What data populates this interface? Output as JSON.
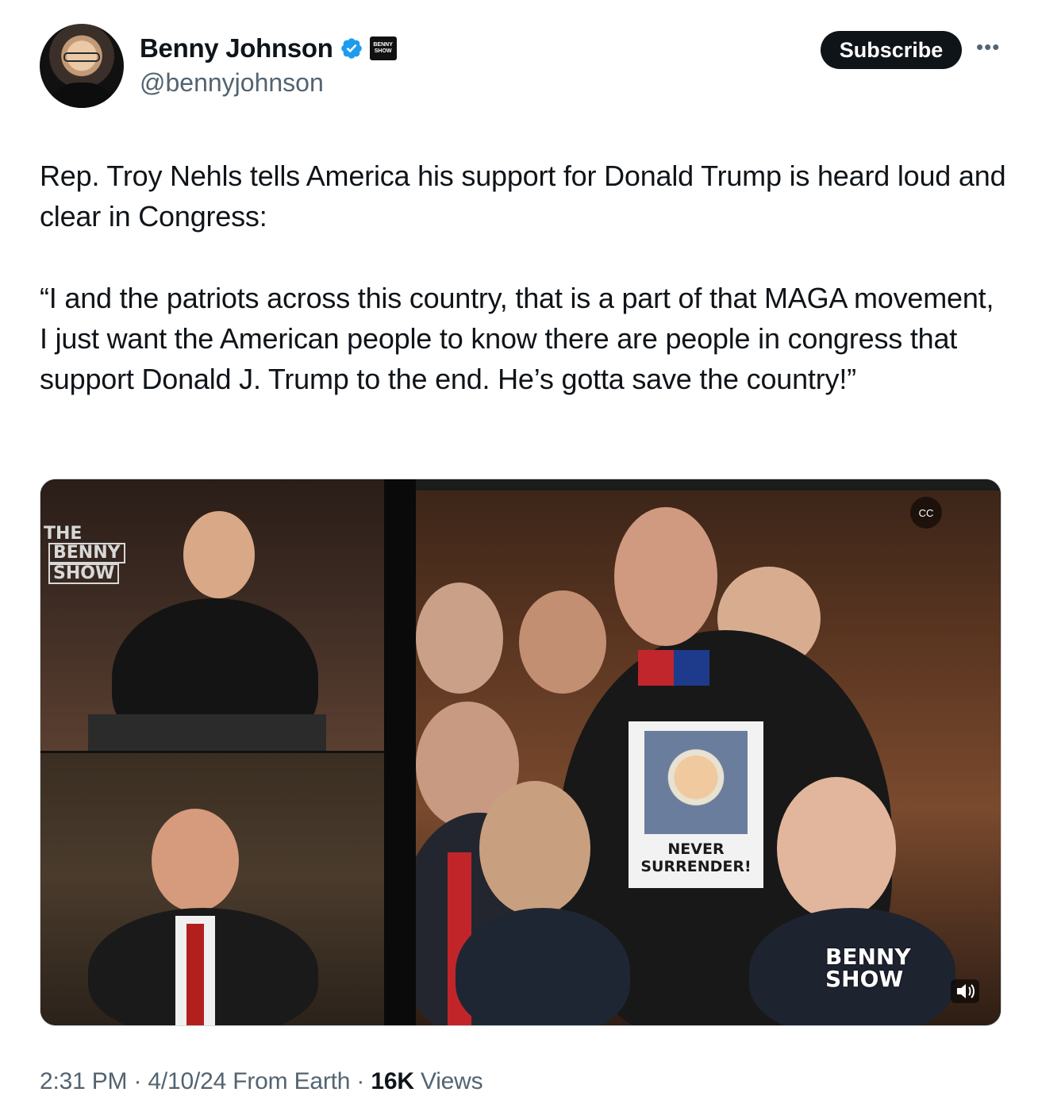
{
  "author": {
    "display_name": "Benny Johnson",
    "handle": "@bennyjohnson",
    "verified_icon": "verified-badge-icon",
    "affiliate_badge_text": "BENNY SHOW",
    "avatar": "avatar-photo"
  },
  "actions": {
    "subscribe_label": "Subscribe",
    "more_icon": "more-horizontal-icon"
  },
  "tweet": {
    "paragraph_1": "Rep. Troy Nehls tells America his support for Donald Trump is heard loud and clear in Congress:",
    "paragraph_2": "“I and the patriots across this country, that is a part of that MAGA movement, I just want the American people to know there are people in congress that support Donald J. Trump to the end. He’s gotta save the country!”"
  },
  "media": {
    "type": "video",
    "logo_line_1": "THE",
    "logo_line_2": "BENNY",
    "logo_line_3": "SHOW",
    "shirt_text_line_1": "NEVER",
    "shirt_text_line_2": "SURRENDER!",
    "watermark_line_1": "BENNY",
    "watermark_line_2": "SHOW",
    "captions_icon": "captions-icon",
    "mute_icon": "volume-icon"
  },
  "meta": {
    "time": "2:31 PM",
    "sep1": "·",
    "date": "4/10/24",
    "source": "From Earth",
    "sep2": "·",
    "views_count": "16K",
    "views_label": "Views"
  },
  "colors": {
    "text": "#0f1419",
    "secondary": "#536471",
    "verified": "#1d9bf0",
    "button_bg": "#0f1419"
  }
}
